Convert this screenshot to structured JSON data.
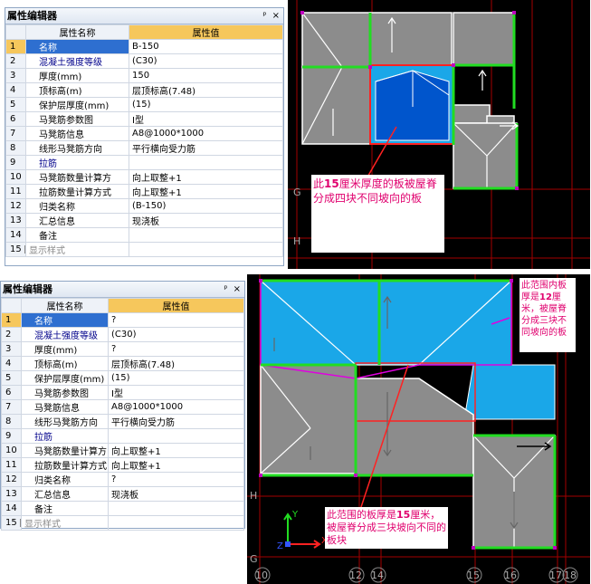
{
  "top_panel": {
    "title": "属性编辑器",
    "pin": "ᵖ",
    "close": "×",
    "col_name": "属性名称",
    "col_value": "属性值",
    "rows": [
      {
        "n": "1",
        "name": "名称",
        "value": "B-150",
        "style": "sel"
      },
      {
        "n": "2",
        "name": "混凝土强度等级",
        "value": "(C30)",
        "style": "blue"
      },
      {
        "n": "3",
        "name": "厚度(mm)",
        "value": "150",
        "style": ""
      },
      {
        "n": "4",
        "name": "顶标高(m)",
        "value": "层顶标高(7.48)",
        "style": ""
      },
      {
        "n": "5",
        "name": "保护层厚度(mm)",
        "value": "(15)",
        "style": ""
      },
      {
        "n": "6",
        "name": "马凳筋参数图",
        "value": "I型",
        "style": ""
      },
      {
        "n": "7",
        "name": "马凳筋信息",
        "value": "A8@1000*1000",
        "style": ""
      },
      {
        "n": "8",
        "name": "线形马凳筋方向",
        "value": "平行横向受力筋",
        "style": ""
      },
      {
        "n": "9",
        "name": "拉筋",
        "value": "",
        "style": "blue"
      },
      {
        "n": "10",
        "name": "马凳筋数量计算方",
        "value": "向上取整+1",
        "style": ""
      },
      {
        "n": "11",
        "name": "拉筋数量计算方式",
        "value": "向上取整+1",
        "style": ""
      },
      {
        "n": "12",
        "name": "归类名称",
        "value": "(B-150)",
        "style": ""
      },
      {
        "n": "13",
        "name": "汇总信息",
        "value": "现浇板",
        "style": ""
      },
      {
        "n": "14",
        "name": "备注",
        "value": "",
        "style": ""
      },
      {
        "n": "15",
        "name": "显示样式",
        "value": "",
        "style": "gray",
        "plus": "+"
      }
    ]
  },
  "bottom_panel": {
    "title": "属性编辑器",
    "pin": "ᵖ",
    "close": "×",
    "col_name": "属性名称",
    "col_value": "属性值",
    "rows": [
      {
        "n": "1",
        "name": "名称",
        "value": "?",
        "style": "sel"
      },
      {
        "n": "2",
        "name": "混凝土强度等级",
        "value": "(C30)",
        "style": "blue"
      },
      {
        "n": "3",
        "name": "厚度(mm)",
        "value": "?",
        "style": ""
      },
      {
        "n": "4",
        "name": "顶标高(m)",
        "value": "层顶标高(7.48)",
        "style": ""
      },
      {
        "n": "5",
        "name": "保护层厚度(mm)",
        "value": "(15)",
        "style": ""
      },
      {
        "n": "6",
        "name": "马凳筋参数图",
        "value": "I型",
        "style": ""
      },
      {
        "n": "7",
        "name": "马凳筋信息",
        "value": "A8@1000*1000",
        "style": ""
      },
      {
        "n": "8",
        "name": "线形马凳筋方向",
        "value": "平行横向受力筋",
        "style": ""
      },
      {
        "n": "9",
        "name": "拉筋",
        "value": "",
        "style": "blue"
      },
      {
        "n": "10",
        "name": "马凳筋数量计算方",
        "value": "向上取整+1",
        "style": ""
      },
      {
        "n": "11",
        "name": "拉筋数量计算方式",
        "value": "向上取整+1",
        "style": ""
      },
      {
        "n": "12",
        "name": "归类名称",
        "value": "?",
        "style": ""
      },
      {
        "n": "13",
        "name": "汇总信息",
        "value": "现浇板",
        "style": ""
      },
      {
        "n": "14",
        "name": "备注",
        "value": "",
        "style": ""
      },
      {
        "n": "15",
        "name": "显示样式",
        "value": "",
        "style": "gray",
        "plus": "+"
      }
    ]
  },
  "top_cad": {
    "note_pre": "此",
    "note_bold": "15",
    "note_post": "厘米厚度的板被屋脊分成四块不同坡向的板",
    "axis_labels": [
      "G",
      "H"
    ]
  },
  "bottom_cad": {
    "note_right_pre": "此范围内板厚是",
    "note_right_bold": "12",
    "note_right_post": "厘米，被屋脊分成三块不同坡向的板",
    "note_bottom_pre": "此范围的板厚是",
    "note_bottom_bold": "15",
    "note_bottom_post": "厘米，被屋脊分成三块坡向不同的板块",
    "axis_left": [
      "H",
      "G"
    ],
    "axis_bottom": [
      "10",
      "12",
      "14",
      "15",
      "16",
      "17",
      "18"
    ],
    "ucs_y": "Y",
    "ucs_x": "X",
    "ucs_z": "Z"
  },
  "colors": {
    "slab_blue": "#1aa7e8",
    "slab_dark": "#0055cc",
    "roof_gray": "#8c8c8c",
    "beam_green": "#22dd22",
    "note_pink": "#e0006e",
    "sel_row": "#2e6fd0",
    "header_orange": "#f6c75c"
  }
}
